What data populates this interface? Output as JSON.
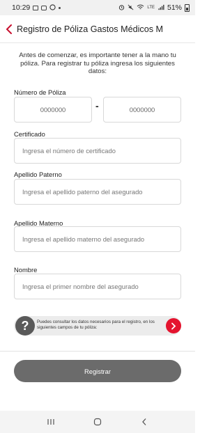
{
  "status_bar": {
    "time": "10:29",
    "battery": "51%",
    "left_icons": [
      "image-icon",
      "message-icon",
      "whatsapp-icon",
      "dot-icon"
    ],
    "right_icons": [
      "alarm-icon",
      "mute-icon",
      "wifi-icon",
      "volte-icon",
      "signal-icon",
      "battery-icon"
    ]
  },
  "header": {
    "title": "Registro de Póliza Gastos Médicos M",
    "accent_color": "#c8102e"
  },
  "intro": "Antes de comenzar, es importante tener a la mano tu póliza. Para registrar tu póliza ingresa los siguientes datos:",
  "fields": {
    "policy_number": {
      "label": "Número de Póliza",
      "part1_placeholder": "0000000",
      "separator": "-",
      "part2_placeholder": "0000000"
    },
    "certificate": {
      "label": "Certificado",
      "placeholder": "Ingresa el número de certificado"
    },
    "paternal_surname": {
      "label": "Apellido Paterno",
      "placeholder": "Ingresa el apellido paterno del asegurado"
    },
    "maternal_surname": {
      "label": "Apellido Materno",
      "placeholder": "Ingresa el apellido materno del asegurado"
    },
    "first_name": {
      "label": "Nombre",
      "placeholder": "Ingresa el primer nombre del asegurado"
    }
  },
  "help": {
    "icon": "?",
    "text": "Puedes consultar los datos necesarios para el registro, en los siguientes campos de tu póliza:"
  },
  "submit": {
    "label": "Registrar",
    "color": "#6b6b6b"
  },
  "nav": {
    "icons": [
      "recent-apps-icon",
      "home-icon",
      "back-icon"
    ]
  }
}
